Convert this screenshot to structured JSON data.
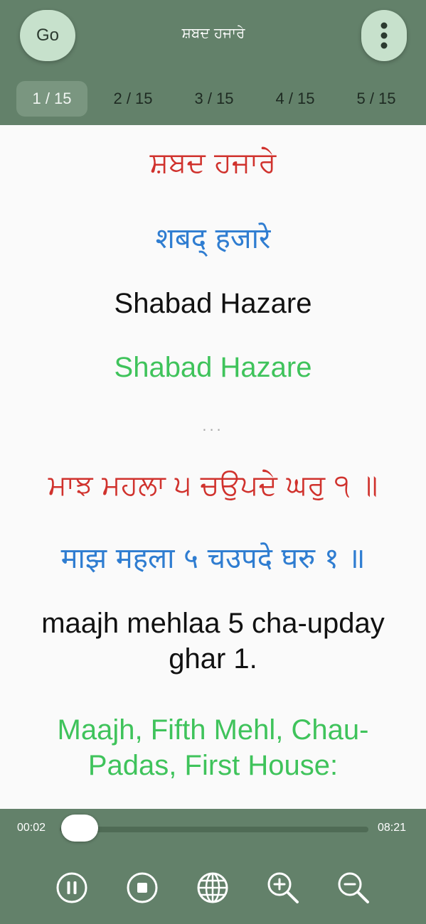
{
  "header": {
    "go_label": "Go",
    "title": "ਸ਼ਬਦ ਹਜਾਰੇ",
    "menu_icon": "more-vertical-icon"
  },
  "tabs": [
    {
      "label": "1 / 15",
      "active": true
    },
    {
      "label": "2 / 15",
      "active": false
    },
    {
      "label": "3 / 15",
      "active": false
    },
    {
      "label": "4 / 15",
      "active": false
    },
    {
      "label": "5 / 15",
      "active": false
    }
  ],
  "content": {
    "heading_gurmukhi": "ਸ਼ਬਦ ਹਜਾਰੇ",
    "heading_devanagari": "शबद् हजारे",
    "heading_transliteration": "Shabad Hazare",
    "heading_translation": "Shabad Hazare",
    "separator": "...",
    "verse_gurmukhi": "ਮਾਝ ਮਹਲਾ ੫ ਚਉਪਦੇ ਘਰੁ ੧ ॥",
    "verse_devanagari": "माझ महला ५ चउपदे घरु १ ॥",
    "verse_transliteration": "maajh mehlaa 5 cha-upday ghar 1.",
    "verse_translation": "Maajh, Fifth Mehl, Chau-Padas, First House:"
  },
  "player": {
    "elapsed": "00:02",
    "duration": "08:21",
    "progress": 0.004,
    "controls": [
      {
        "name": "pause-icon"
      },
      {
        "name": "stop-icon"
      },
      {
        "name": "globe-icon"
      },
      {
        "name": "zoom-in-icon"
      },
      {
        "name": "zoom-out-icon"
      }
    ]
  },
  "colors": {
    "header_bg": "#63816a",
    "gurmukhi": "#d0322d",
    "devanagari": "#2f7dd1",
    "translation": "#3fc35b",
    "button_bg": "#c7e1cc"
  }
}
